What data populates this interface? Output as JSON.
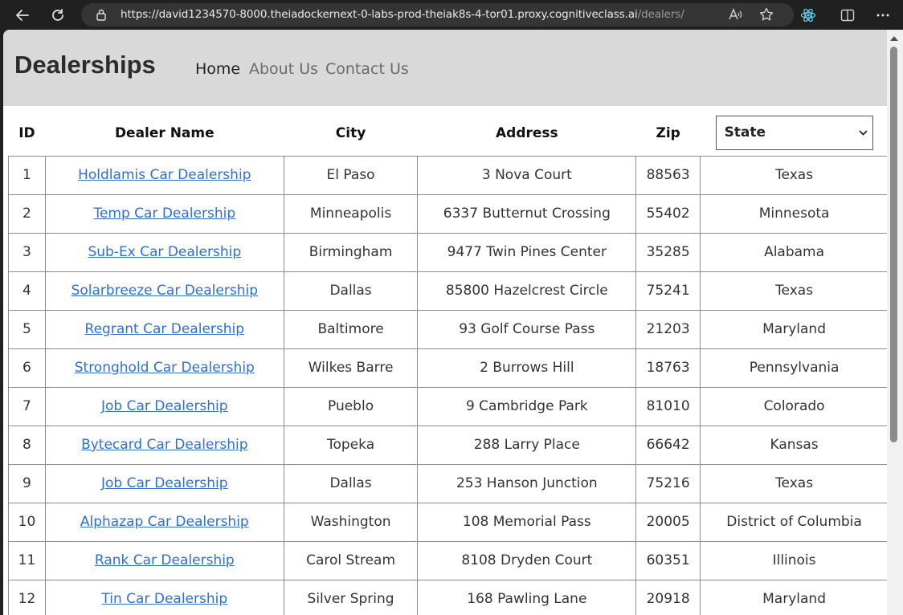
{
  "browser": {
    "url_host": "https://david1234570-8000.theiadockernext-0-labs-prod-theiak8s-4-tor01.proxy.cognitiveclass.ai",
    "url_path": "/dealers/"
  },
  "header": {
    "brand": "Dealerships",
    "nav": [
      {
        "label": "Home",
        "active": true
      },
      {
        "label": "About Us",
        "active": false
      },
      {
        "label": "Contact Us",
        "active": false
      }
    ]
  },
  "table": {
    "columns": [
      "ID",
      "Dealer Name",
      "City",
      "Address",
      "Zip"
    ],
    "state_filter": {
      "selected": "State"
    },
    "rows": [
      {
        "id": "1",
        "name": "Holdlamis Car Dealership",
        "city": "El Paso",
        "address": "3 Nova Court",
        "zip": "88563",
        "state": "Texas"
      },
      {
        "id": "2",
        "name": "Temp Car Dealership",
        "city": "Minneapolis",
        "address": "6337 Butternut Crossing",
        "zip": "55402",
        "state": "Minnesota"
      },
      {
        "id": "3",
        "name": "Sub-Ex Car Dealership",
        "city": "Birmingham",
        "address": "9477 Twin Pines Center",
        "zip": "35285",
        "state": "Alabama"
      },
      {
        "id": "4",
        "name": "Solarbreeze Car Dealership",
        "city": "Dallas",
        "address": "85800 Hazelcrest Circle",
        "zip": "75241",
        "state": "Texas"
      },
      {
        "id": "5",
        "name": "Regrant Car Dealership",
        "city": "Baltimore",
        "address": "93 Golf Course Pass",
        "zip": "21203",
        "state": "Maryland"
      },
      {
        "id": "6",
        "name": "Stronghold Car Dealership",
        "city": "Wilkes Barre",
        "address": "2 Burrows Hill",
        "zip": "18763",
        "state": "Pennsylvania"
      },
      {
        "id": "7",
        "name": "Job Car Dealership",
        "city": "Pueblo",
        "address": "9 Cambridge Park",
        "zip": "81010",
        "state": "Colorado"
      },
      {
        "id": "8",
        "name": "Bytecard Car Dealership",
        "city": "Topeka",
        "address": "288 Larry Place",
        "zip": "66642",
        "state": "Kansas"
      },
      {
        "id": "9",
        "name": "Job Car Dealership",
        "city": "Dallas",
        "address": "253 Hanson Junction",
        "zip": "75216",
        "state": "Texas"
      },
      {
        "id": "10",
        "name": "Alphazap Car Dealership",
        "city": "Washington",
        "address": "108 Memorial Pass",
        "zip": "20005",
        "state": "District of Columbia"
      },
      {
        "id": "11",
        "name": "Rank Car Dealership",
        "city": "Carol Stream",
        "address": "8108 Dryden Court",
        "zip": "60351",
        "state": "Illinois"
      },
      {
        "id": "12",
        "name": "Tin Car Dealership",
        "city": "Silver Spring",
        "address": "168 Pawling Lane",
        "zip": "20918",
        "state": "Maryland"
      }
    ]
  }
}
